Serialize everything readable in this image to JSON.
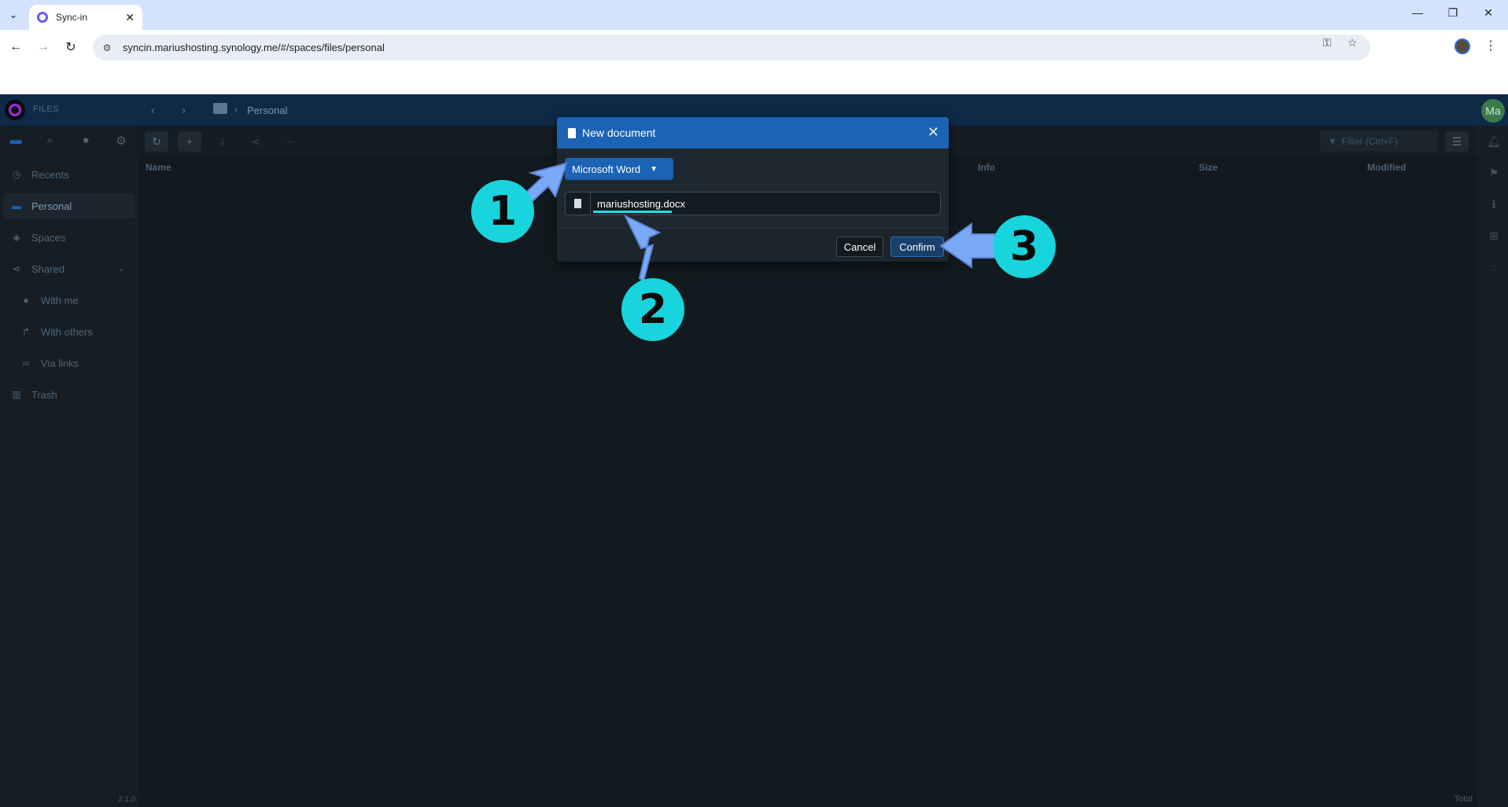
{
  "browser": {
    "tab_title": "Sync-in",
    "url": "syncin.mariushosting.synology.me/#/spaces/files/personal"
  },
  "app": {
    "section_label": "FILES",
    "breadcrumb": "Personal",
    "avatar_initials": "Ma",
    "version": "2.1.0",
    "total_label": "Total",
    "filter_placeholder": "Filter (Ctrl+F)"
  },
  "sidebar": {
    "items": [
      {
        "label": "Recents",
        "icon": "clock-icon"
      },
      {
        "label": "Personal",
        "icon": "folder-icon"
      },
      {
        "label": "Spaces",
        "icon": "layers-icon"
      },
      {
        "label": "Shared",
        "icon": "share-icon"
      },
      {
        "label": "With me",
        "icon": "user-icon"
      },
      {
        "label": "With others",
        "icon": "forward-icon"
      },
      {
        "label": "Via links",
        "icon": "link-icon"
      },
      {
        "label": "Trash",
        "icon": "trash-icon"
      }
    ]
  },
  "table": {
    "columns": [
      "Name",
      "Info",
      "Size",
      "Modified"
    ]
  },
  "modal": {
    "title": "New document",
    "type_selected": "Microsoft Word",
    "filename": "mariushosting.docx",
    "cancel_label": "Cancel",
    "confirm_label": "Confirm"
  },
  "annotations": [
    "1",
    "2",
    "3"
  ],
  "colors": {
    "accent": "#1a63b5",
    "annotation": "#18d4dc",
    "arrow": "#7aa9f7",
    "header": "#0f2a47"
  }
}
